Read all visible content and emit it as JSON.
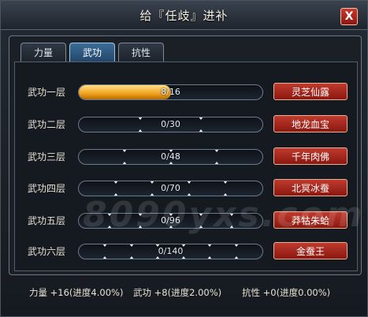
{
  "window": {
    "title": "给『任歧』进补",
    "close_label": "X"
  },
  "tabs": [
    {
      "label": "力量",
      "active": false
    },
    {
      "label": "武功",
      "active": true
    },
    {
      "label": "抗性",
      "active": false
    }
  ],
  "rows": [
    {
      "label": "武功一层",
      "progress": "8/16",
      "fraction": 0.5,
      "item": "灵芝仙露"
    },
    {
      "label": "武功二层",
      "progress": "0/30",
      "fraction": 0,
      "item": "地龙血宝"
    },
    {
      "label": "武功三层",
      "progress": "0/48",
      "fraction": 0,
      "item": "千年肉佛"
    },
    {
      "label": "武功四层",
      "progress": "0/70",
      "fraction": 0,
      "item": "北冥冰蚕"
    },
    {
      "label": "武功五层",
      "progress": "0/96",
      "fraction": 0,
      "item": "莽牯朱蛤"
    },
    {
      "label": "武功六层",
      "progress": "0/140",
      "fraction": 0,
      "item": "金蚕王"
    }
  ],
  "footer": {
    "strength": "力量 +16(进度4.00%)",
    "martial": "武功 +8(进度2.00%)",
    "resist": "抗性 +0(进度0.00%)"
  },
  "watermark": "8090yxs.com",
  "colors": {
    "accent_button": "#a6261b",
    "progress_fill": "#f0a21c",
    "active_tab": "#2f5a83"
  }
}
